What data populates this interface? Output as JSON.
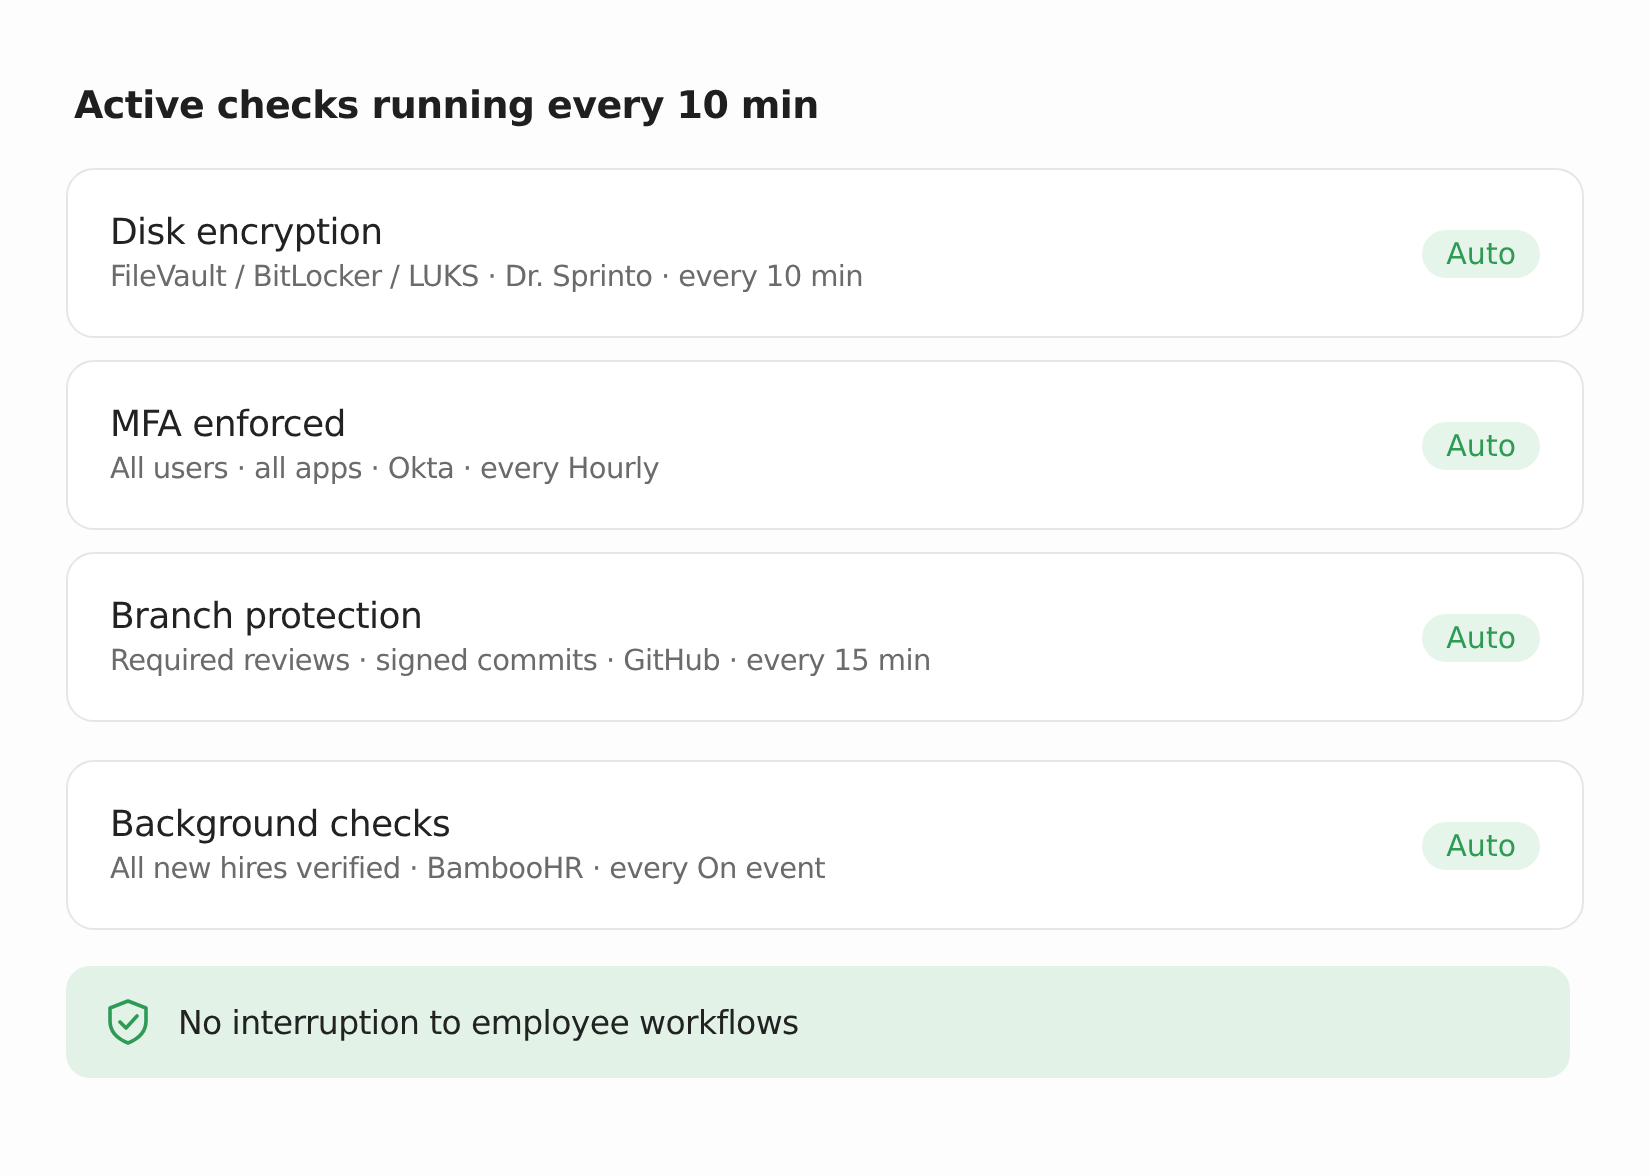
{
  "heading": "Active checks running every 10 min",
  "checks": [
    {
      "title": "Disk encryption",
      "detail": "FileVault / BitLocker / LUKS · Dr. Sprinto · every 10 min",
      "badge": "Auto"
    },
    {
      "title": "MFA enforced",
      "detail": "All users · all apps · Okta · every Hourly",
      "badge": "Auto"
    },
    {
      "title": "Branch protection",
      "detail": "Required reviews · signed commits · GitHub · every 15 min",
      "badge": "Auto"
    },
    {
      "title": "Background checks",
      "detail": "All new hires verified · BambooHR · every On event",
      "badge": "Auto"
    }
  ],
  "notice": "No interruption to employee workflows"
}
